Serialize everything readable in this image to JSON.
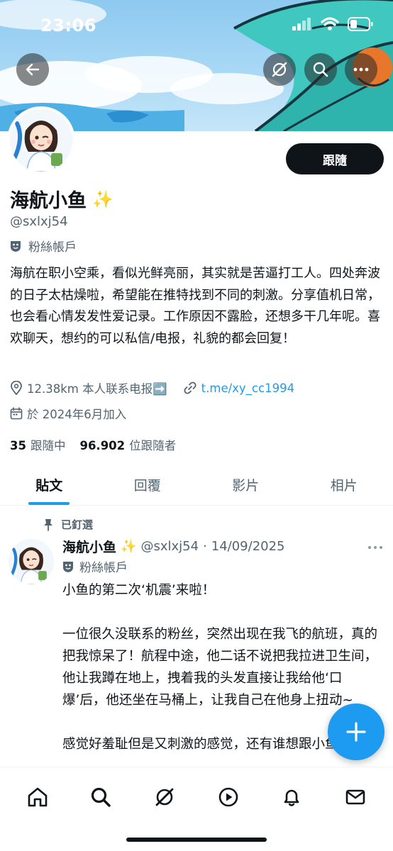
{
  "status_bar": {
    "time": "23:06"
  },
  "profile": {
    "display_name": "海航小鱼",
    "sparkle": "✨",
    "handle": "@sxlxj54",
    "account_type": "粉絲帳戶",
    "follow_label": "跟隨",
    "bio": "海航在职小空乘，看似光鲜亮丽，其实就是苦逼打工人。四处奔波的日子太枯燥啦，希望能在推特找到不同的刺激。分享值机日常，也会看心情发发性爱记录。工作原因不露脸，还想多干几年呢。喜欢聊天，想约的可以私信/电报，礼貌的都会回复！",
    "location": "12.38km 本人联系电报➡️",
    "link": "t.me/xy_cc1994",
    "joined": "於 2024年6月加入",
    "following_count": "35",
    "following_label": "跟隨中",
    "followers_count": "96.902",
    "followers_label": "位跟隨者"
  },
  "tabs": [
    {
      "label": "貼文",
      "active": true
    },
    {
      "label": "回覆",
      "active": false
    },
    {
      "label": "影片",
      "active": false
    },
    {
      "label": "相片",
      "active": false
    }
  ],
  "post": {
    "pinned_label": "已釘選",
    "author_name": "海航小鱼",
    "sparkle": "✨",
    "author_handle": "@sxlxj54",
    "separator": "·",
    "date": "14/09/2025",
    "account_type": "粉絲帳戶",
    "paragraphs": [
      "小鱼的第二次‘机震’来啦！",
      "一位很久没联系的粉丝，突然出现在我飞的航班，真的把我惊呆了！航程中途，他二话不说把我拉进卫生间，他让我蹲在地上，拽着我的头发直接让我给他‘口爆’后，他还坐在马桶上，让我自己在他身上扭动~",
      "感觉好羞耻但是又刺激的感觉，还有谁想跟小鱼"
    ]
  },
  "colors": {
    "accent": "#1d9bf0",
    "text": "#0f1419",
    "secondary": "#536471"
  }
}
